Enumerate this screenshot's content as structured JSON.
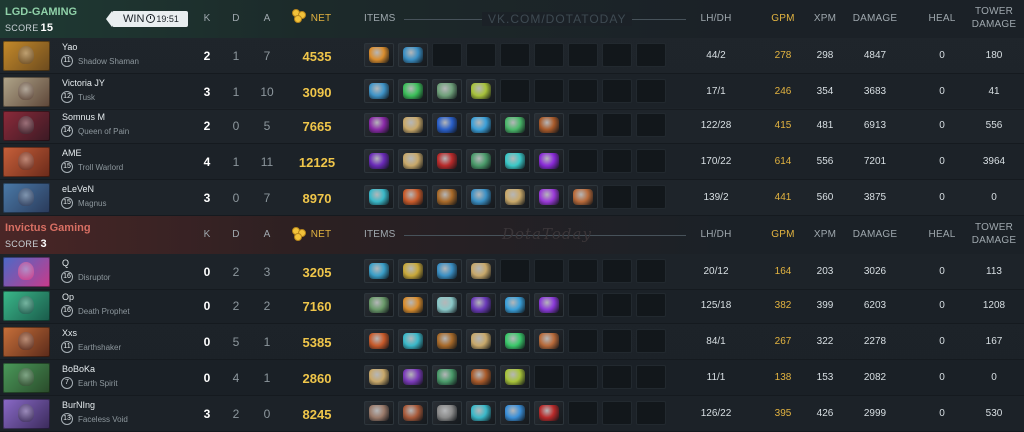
{
  "columns": {
    "k": "K",
    "d": "D",
    "a": "A",
    "net": "NET",
    "items": "ITEMS",
    "lhdh": "LH/DH",
    "gpm": "GPM",
    "xpm": "XPM",
    "damage": "DAMAGE",
    "heal": "HEAL",
    "tower_damage_1": "TOWER",
    "tower_damage_2": "DAMAGE"
  },
  "watermark_top": "VK.COM/DOTATODAY",
  "watermark_mid": "DotaToday",
  "result": {
    "label": "WIN",
    "time": "19:51"
  },
  "teams": [
    {
      "name": "LGD-GAMING",
      "score_label": "SCORE",
      "score": "15",
      "players": [
        {
          "name": "Yao",
          "level": "11",
          "hero": "Shadow Shaman",
          "k": "2",
          "d": "1",
          "a": "7",
          "net": "4535",
          "lhdh": "44/2",
          "gpm": "278",
          "xpm": "298",
          "damage": "4847",
          "heal": "0",
          "tower": "180",
          "portrait": [
            "#c58a2a",
            "#6b4a1e"
          ],
          "items": [
            "#d98d2e",
            "#3a8fc4"
          ]
        },
        {
          "name": "Victoria JY",
          "level": "12",
          "hero": "Tusk",
          "k": "3",
          "d": "1",
          "a": "10",
          "net": "3090",
          "lhdh": "17/1",
          "gpm": "246",
          "xpm": "354",
          "damage": "3683",
          "heal": "0",
          "tower": "41",
          "portrait": [
            "#b0a58a",
            "#5d4638"
          ],
          "items": [
            "#3f94c8",
            "#3cbf5a",
            "#6fa07a",
            "#a7c23a"
          ]
        },
        {
          "name": "Somnus M",
          "level": "14",
          "hero": "Queen of Pain",
          "k": "2",
          "d": "0",
          "a": "5",
          "net": "7665",
          "lhdh": "122/28",
          "gpm": "415",
          "xpm": "481",
          "damage": "6913",
          "heal": "0",
          "tower": "556",
          "portrait": [
            "#8c2a3a",
            "#3a1a24"
          ],
          "items": [
            "#8a2aa8",
            "#c8a86a",
            "#2a5fc8",
            "#3a9fd8",
            "#4ab86a",
            "#a85a2a"
          ]
        },
        {
          "name": "AME",
          "level": "15",
          "hero": "Troll Warlord",
          "k": "4",
          "d": "1",
          "a": "11",
          "net": "12125",
          "lhdh": "170/22",
          "gpm": "614",
          "xpm": "556",
          "damage": "7201",
          "heal": "0",
          "tower": "3964",
          "portrait": [
            "#c8603a",
            "#6a2a1a"
          ],
          "items": [
            "#6a2ab8",
            "#c8a86a",
            "#b82a2a",
            "#4a9a6a",
            "#3ac8c8",
            "#8a2ad8"
          ]
        },
        {
          "name": "eLeVeN",
          "level": "15",
          "hero": "Magnus",
          "k": "3",
          "d": "0",
          "a": "7",
          "net": "8970",
          "lhdh": "139/2",
          "gpm": "441",
          "xpm": "560",
          "damage": "3875",
          "heal": "0",
          "tower": "0",
          "portrait": [
            "#4a7aa8",
            "#2a3a5a"
          ],
          "items": [
            "#3ab8c8",
            "#c85a2a",
            "#a86a2a",
            "#3a8fc4",
            "#c8a86a",
            "#9a3ad8",
            "#b86a3a"
          ]
        }
      ]
    },
    {
      "name": "Invictus Gaming",
      "score_label": "SCORE",
      "score": "3",
      "players": [
        {
          "name": "Q",
          "level": "16",
          "hero": "Disruptor",
          "k": "0",
          "d": "2",
          "a": "3",
          "net": "3205",
          "lhdh": "20/12",
          "gpm": "164",
          "xpm": "203",
          "damage": "3026",
          "heal": "0",
          "tower": "113",
          "portrait": [
            "#4a6ac8",
            "#c83a8a"
          ],
          "items": [
            "#3a9fc8",
            "#c8a83a",
            "#3a8fc4",
            "#c8a86a"
          ]
        },
        {
          "name": "Op",
          "level": "16",
          "hero": "Death Prophet",
          "k": "0",
          "d": "2",
          "a": "2",
          "net": "7160",
          "lhdh": "125/18",
          "gpm": "382",
          "xpm": "399",
          "damage": "6203",
          "heal": "0",
          "tower": "1208",
          "portrait": [
            "#3ab88a",
            "#1a5a4a"
          ],
          "items": [
            "#6a9a6a",
            "#d98d2e",
            "#8ac8c8",
            "#6a3ab8",
            "#3a9fd8",
            "#8a3ad8"
          ]
        },
        {
          "name": "Xxs",
          "level": "11",
          "hero": "Earthshaker",
          "k": "0",
          "d": "5",
          "a": "1",
          "net": "5385",
          "lhdh": "84/1",
          "gpm": "267",
          "xpm": "322",
          "damage": "2278",
          "heal": "0",
          "tower": "167",
          "portrait": [
            "#c8703a",
            "#5a2a1a"
          ],
          "items": [
            "#c85a2a",
            "#3ab8c8",
            "#a86a2a",
            "#c8a86a",
            "#3ac86a",
            "#b86a3a"
          ]
        },
        {
          "name": "BoBoKa",
          "level": "7",
          "hero": "Earth Spirit",
          "k": "0",
          "d": "4",
          "a": "1",
          "net": "2860",
          "lhdh": "11/1",
          "gpm": "138",
          "xpm": "153",
          "damage": "2082",
          "heal": "0",
          "tower": "0",
          "portrait": [
            "#4a9a5a",
            "#2a4a2a"
          ],
          "items": [
            "#c8a86a",
            "#7a3ab8",
            "#4a9a6a",
            "#a85a2a",
            "#a7c23a"
          ]
        },
        {
          "name": "BurNIng",
          "level": "13",
          "hero": "Faceless Void",
          "k": "3",
          "d": "2",
          "a": "0",
          "net": "8245",
          "lhdh": "126/22",
          "gpm": "395",
          "xpm": "426",
          "damage": "2999",
          "heal": "0",
          "tower": "530",
          "portrait": [
            "#8a6ac8",
            "#3a2a5a"
          ],
          "items": [
            "#9a7a6a",
            "#a85a3a",
            "#8a8a8a",
            "#3ab8c8",
            "#3a8fd8",
            "#b82a2a"
          ]
        }
      ]
    }
  ]
}
